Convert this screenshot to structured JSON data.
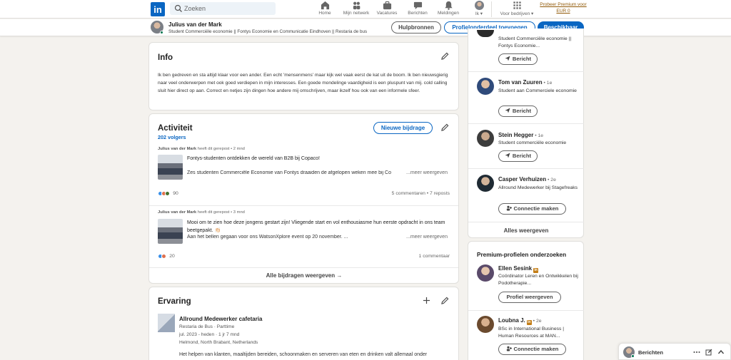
{
  "nav": {
    "logo": "in",
    "search_placeholder": "Zoeken",
    "items": [
      {
        "label": "Home",
        "icon": "home-icon"
      },
      {
        "label": "Mijn netwerk",
        "icon": "network-icon"
      },
      {
        "label": "Vacatures",
        "icon": "jobs-icon"
      },
      {
        "label": "Berichten",
        "icon": "messaging-icon"
      },
      {
        "label": "Meldingen",
        "icon": "bell-icon"
      },
      {
        "label": "Ik",
        "icon": "avatar"
      },
      {
        "label": "Voor bedrijven",
        "icon": "grid-icon"
      }
    ],
    "premium_line1": "Probeer Premium voor",
    "premium_line2": "EUR 0"
  },
  "profile_bar": {
    "name": "Julius van der Mark",
    "headline": "Student Commerciële economie || Fontys Economie en Communicatie Eindhoven || Restaria de bus",
    "btn_help": "Hulpbronnen",
    "btn_add_section": "Profielonderdeel toevoegen",
    "btn_available": "Beschikbaar"
  },
  "info": {
    "title": "Info",
    "text": "Ik ben gedreven en sta altijd klaar voor een ander. Een echt 'mensenmens' maar kijk wel vaak eerst de kat uit de boom. Ik ben nieuwsgierig naar veel onderwerpen met ook goed verdiepen in mijn interesses. Een goede mondelinge vaardigheid is een pluspunt van mij. cold calling sluit hier direct op aan. Correct en netjes zijn dingen hoe andere mij omschrijven, maar ikzelf hou ook van een informele sfeer."
  },
  "activity": {
    "title": "Activiteit",
    "followers": "202 volgers",
    "new_post": "Nieuwe bijdrage",
    "show_all": "Alle bijdragen weergeven →",
    "posts": [
      {
        "author": "Julius van der Mark",
        "meta": " heeft dit gerepost • 2 mnd",
        "title": "Fontys-studenten ontdekken de wereld van B2B bij Copaco!",
        "body": "Zes studenten Commerciële Economie van Fontys draaiden de afgelopen weken mee bij Co",
        "more": "...meer weergeven",
        "reaction_count": "90",
        "stats": "5 commentaren • 7 reposts"
      },
      {
        "author": "Julius van der Mark",
        "meta": " heeft dit gerepost • 3 mnd",
        "title": "Mooi om te zien hoe deze jongens gestart zijn! Vliegende start en vol enthousiasme hun eerste opdracht in ons team beetgepakt. 👏🏻",
        "body": "Aan het bellen gegaan voor ons WatsonXplore event op 20 november. ...",
        "more": "...meer weergeven",
        "reaction_count": "20",
        "stats": "1 commentaar"
      }
    ]
  },
  "experience": {
    "title": "Ervaring",
    "role": "Allround Medewerker cafetaria",
    "company": "Restaria de Bus · Parttime",
    "period": "jul. 2023 - heden · 1 jr 7 mnd",
    "location": "Helmond, North Brabant, Netherlands",
    "description": "Het helpen van klanten, maaltijden bereiden, schoonmaken en serveren van eten en drinken valt allemaal onder"
  },
  "people": {
    "partial_headline": "Student Commerciële economie || Fontys Economie...",
    "partial_button": "Bericht",
    "items": [
      {
        "name": "Tom van Zuuren",
        "degree": " • 1e",
        "headline": "Student aan Commerciele economie",
        "button": "Bericht"
      },
      {
        "name": "Stein Hegger",
        "degree": " • 1e",
        "headline": "Student commerciële economie",
        "button": "Bericht"
      },
      {
        "name": "Casper Verhuizen",
        "degree": " • 2e",
        "headline": "Allround Medewerker bij Stagefreaks",
        "button": "Connectie maken"
      }
    ],
    "show_all": "Alles weergeven"
  },
  "premium_profiles": {
    "title": "Premium-profielen onderzoeken",
    "items": [
      {
        "name": "Ellen Sesink",
        "degree": "",
        "headline": "Coördinator Leren en Ontwikkelen bij Podotherapie...",
        "button": "Profiel weergeven"
      },
      {
        "name": "Loubna J.",
        "degree": " • 2e",
        "headline": "BSc in International Business | Human Resources at MAN...",
        "button": "Connectie maken"
      }
    ]
  },
  "messaging": {
    "label": "Berichten"
  },
  "colors": {
    "brand_blue": "#0a66c2",
    "background": "#f4f2ee",
    "online_green": "#01754f",
    "premium_gold": "#915907"
  }
}
